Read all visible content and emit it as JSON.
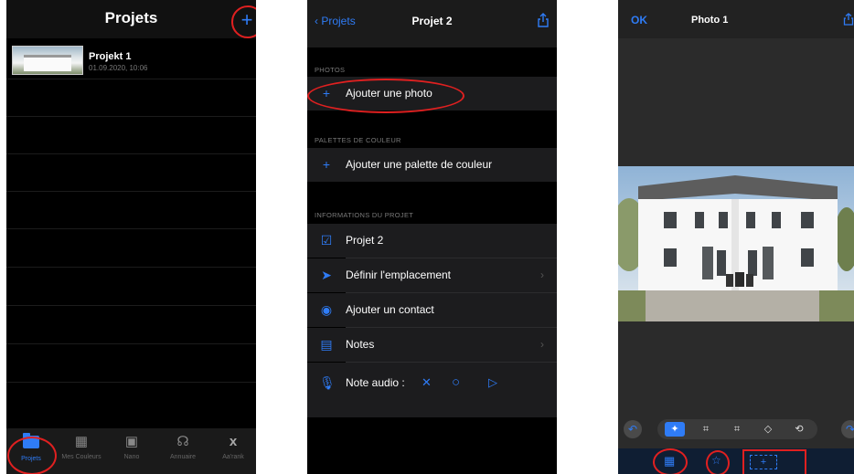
{
  "screen1": {
    "title": "Projets",
    "add_icon": "plus-icon",
    "project": {
      "name": "Projekt 1",
      "date": "01.09.2020, 10:06"
    },
    "tabs": [
      {
        "label": "Projets",
        "icon": "folder-icon",
        "active": true
      },
      {
        "label": "Mes Couleurs",
        "icon": "palette-icon",
        "active": false
      },
      {
        "label": "Nano",
        "icon": "nano-icon",
        "active": false
      },
      {
        "label": "Annuaire",
        "icon": "headset-icon",
        "active": false
      },
      {
        "label": "Aa'rank",
        "icon": "x-icon",
        "active": false
      }
    ]
  },
  "screen2": {
    "back_label": "Projets",
    "title": "Projet 2",
    "sections": {
      "photos": "PHOTOS",
      "palettes": "PALETTES DE COULEUR",
      "info": "INFORMATIONS DU PROJET"
    },
    "rows": {
      "add_photo": "Ajouter une photo",
      "add_palette": "Ajouter une palette de couleur",
      "project_name": "Projet 2",
      "location": "Définir l'emplacement",
      "contact": "Ajouter un contact",
      "notes": "Notes",
      "audio": "Note audio :"
    }
  },
  "screen3": {
    "ok_label": "OK",
    "title": "Photo 1"
  },
  "colors": {
    "accent": "#2f7cf6",
    "annotation": "#e02020",
    "background": "#000000"
  }
}
